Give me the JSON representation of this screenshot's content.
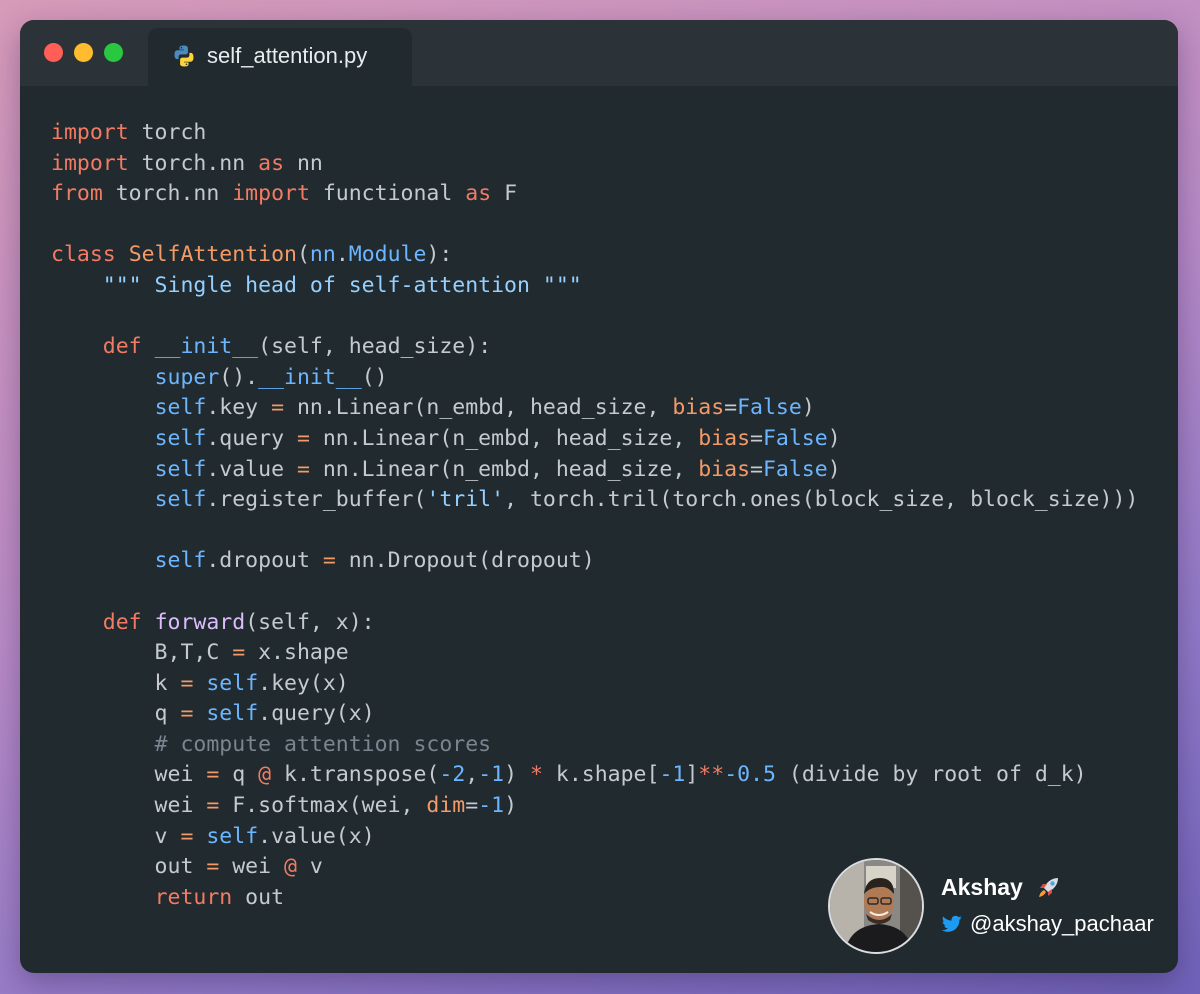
{
  "window": {
    "controls": [
      "close",
      "minimize",
      "maximize"
    ],
    "tab": {
      "icon": "python-icon",
      "filename": "self_attention.py"
    }
  },
  "code": {
    "language": "python",
    "lines": [
      [
        [
          "k",
          "import"
        ],
        [
          "p",
          " torch"
        ]
      ],
      [
        [
          "k",
          "import"
        ],
        [
          "p",
          " torch.nn "
        ],
        [
          "k",
          "as"
        ],
        [
          "p",
          " nn"
        ]
      ],
      [
        [
          "k",
          "from"
        ],
        [
          "p",
          " torch.nn "
        ],
        [
          "k",
          "import"
        ],
        [
          "p",
          " functional "
        ],
        [
          "k",
          "as"
        ],
        [
          "p",
          " F"
        ]
      ],
      [],
      [
        [
          "k",
          "class"
        ],
        [
          "p",
          " "
        ],
        [
          "cl",
          "SelfAttention"
        ],
        [
          "p",
          "("
        ],
        [
          "b",
          "nn"
        ],
        [
          "p",
          "."
        ],
        [
          "b",
          "Module"
        ],
        [
          "p",
          "):"
        ]
      ],
      [
        [
          "p",
          "    "
        ],
        [
          "s",
          "\"\"\" Single head of self-attention \"\"\""
        ]
      ],
      [],
      [
        [
          "p",
          "    "
        ],
        [
          "k",
          "def"
        ],
        [
          "p",
          " "
        ],
        [
          "b",
          "__init__"
        ],
        [
          "p",
          "(self, head_size):"
        ]
      ],
      [
        [
          "p",
          "        "
        ],
        [
          "b",
          "super"
        ],
        [
          "p",
          "()."
        ],
        [
          "b",
          "__init__"
        ],
        [
          "p",
          "()"
        ]
      ],
      [
        [
          "p",
          "        "
        ],
        [
          "b",
          "self"
        ],
        [
          "p",
          ".key "
        ],
        [
          "o",
          "="
        ],
        [
          "p",
          " nn.Linear(n_embd, head_size, "
        ],
        [
          "o",
          "bias"
        ],
        [
          "p",
          "="
        ],
        [
          "b",
          "False"
        ],
        [
          "p",
          ")"
        ]
      ],
      [
        [
          "p",
          "        "
        ],
        [
          "b",
          "self"
        ],
        [
          "p",
          ".query "
        ],
        [
          "o",
          "="
        ],
        [
          "p",
          " nn.Linear(n_embd, head_size, "
        ],
        [
          "o",
          "bias"
        ],
        [
          "p",
          "="
        ],
        [
          "b",
          "False"
        ],
        [
          "p",
          ")"
        ]
      ],
      [
        [
          "p",
          "        "
        ],
        [
          "b",
          "self"
        ],
        [
          "p",
          ".value "
        ],
        [
          "o",
          "="
        ],
        [
          "p",
          " nn.Linear(n_embd, head_size, "
        ],
        [
          "o",
          "bias"
        ],
        [
          "p",
          "="
        ],
        [
          "b",
          "False"
        ],
        [
          "p",
          ")"
        ]
      ],
      [
        [
          "p",
          "        "
        ],
        [
          "b",
          "self"
        ],
        [
          "p",
          ".register_buffer("
        ],
        [
          "s",
          "'tril'"
        ],
        [
          "p",
          ", torch.tril(torch.ones(block_size, block_size)))"
        ]
      ],
      [],
      [
        [
          "p",
          "        "
        ],
        [
          "b",
          "self"
        ],
        [
          "p",
          ".dropout "
        ],
        [
          "o",
          "="
        ],
        [
          "p",
          " nn.Dropout(dropout)"
        ]
      ],
      [],
      [
        [
          "p",
          "    "
        ],
        [
          "k",
          "def"
        ],
        [
          "p",
          " "
        ],
        [
          "f",
          "forward"
        ],
        [
          "p",
          "(self, x):"
        ]
      ],
      [
        [
          "p",
          "        B,T,C "
        ],
        [
          "o",
          "="
        ],
        [
          "p",
          " x.shape"
        ]
      ],
      [
        [
          "p",
          "        k "
        ],
        [
          "o",
          "="
        ],
        [
          "p",
          " "
        ],
        [
          "b",
          "self"
        ],
        [
          "p",
          ".key(x)"
        ]
      ],
      [
        [
          "p",
          "        q "
        ],
        [
          "o",
          "="
        ],
        [
          "p",
          " "
        ],
        [
          "b",
          "self"
        ],
        [
          "p",
          ".query(x)"
        ]
      ],
      [
        [
          "p",
          "        "
        ],
        [
          "c",
          "# compute attention scores"
        ]
      ],
      [
        [
          "p",
          "        wei "
        ],
        [
          "o",
          "="
        ],
        [
          "p",
          " q "
        ],
        [
          "k",
          "@"
        ],
        [
          "p",
          " k.transpose("
        ],
        [
          "n",
          "-2"
        ],
        [
          "p",
          ","
        ],
        [
          "n",
          "-1"
        ],
        [
          "p",
          ") "
        ],
        [
          "k",
          "*"
        ],
        [
          "p",
          " k.shape["
        ],
        [
          "n",
          "-1"
        ],
        [
          "p",
          "]"
        ],
        [
          "k",
          "**"
        ],
        [
          "n",
          "-0.5"
        ],
        [
          "p",
          " (divide by root of d_k)"
        ]
      ],
      [
        [
          "p",
          "        wei "
        ],
        [
          "o",
          "="
        ],
        [
          "p",
          " F.softmax(wei, "
        ],
        [
          "o",
          "dim"
        ],
        [
          "p",
          "="
        ],
        [
          "n",
          "-1"
        ],
        [
          "p",
          ")"
        ]
      ],
      [
        [
          "p",
          "        v "
        ],
        [
          "o",
          "="
        ],
        [
          "p",
          " "
        ],
        [
          "b",
          "self"
        ],
        [
          "p",
          ".value(x)"
        ]
      ],
      [
        [
          "p",
          "        out "
        ],
        [
          "o",
          "="
        ],
        [
          "p",
          " wei "
        ],
        [
          "k",
          "@"
        ],
        [
          "p",
          " v"
        ]
      ],
      [
        [
          "p",
          "        "
        ],
        [
          "k",
          "return"
        ],
        [
          "p",
          " out"
        ]
      ]
    ]
  },
  "author": {
    "name": "Akshay",
    "name_emoji": "rocket-icon",
    "handle": "@akshay_pachaar",
    "handle_icon": "twitter-icon",
    "avatar": "avatar"
  },
  "colors": {
    "window_bg": "#212a2f",
    "titlebar_bg": "#2b3338",
    "keyword": "#f27b63",
    "class_name": "#f39a67",
    "builtin": "#6cb6ff",
    "string": "#96d0ff",
    "function": "#dcbdfb",
    "comment": "#7b8590",
    "plain": "#c4cad0",
    "twitter": "#1d9bf0"
  }
}
